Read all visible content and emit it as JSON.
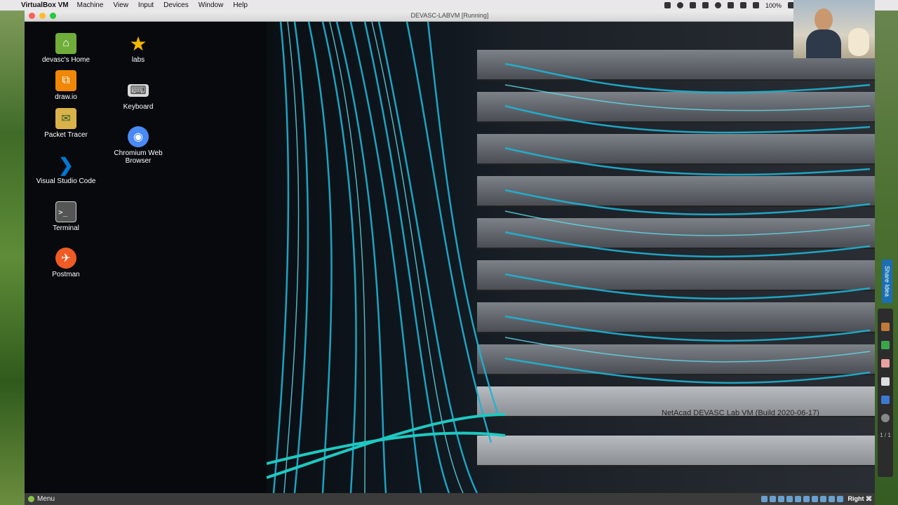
{
  "mac_menubar": {
    "app_name": "VirtualBox VM",
    "menus": [
      "Machine",
      "View",
      "Input",
      "Devices",
      "Window",
      "Help"
    ],
    "battery": "100%"
  },
  "vm_window": {
    "title": "DEVASC-LABVM [Running]"
  },
  "desktop": {
    "icons": [
      {
        "label": "devasc's Home",
        "icon": "folder-home-icon",
        "color": "#6fae3a"
      },
      {
        "label": "labs",
        "icon": "star-icon",
        "color": "#f5b800"
      },
      {
        "label": "draw.io",
        "icon": "drawio-icon",
        "color": "#f08705"
      },
      {
        "label": "Keyboard",
        "icon": "keyboard-icon",
        "color": "#d9d9d9"
      },
      {
        "label": "Packet Tracer",
        "icon": "packet-tracer-icon",
        "color": "#d9b24a"
      },
      {
        "label": "Chromium Web Browser",
        "icon": "chromium-icon",
        "color": "#4a8af4"
      },
      {
        "label": "Visual Studio Code",
        "icon": "vscode-icon",
        "color": "#0078d4"
      },
      {
        "label": "Terminal",
        "icon": "terminal-icon",
        "color": "#555555"
      },
      {
        "label": "Postman",
        "icon": "postman-icon",
        "color": "#ef5b25"
      }
    ],
    "wallpaper_text": "NetAcad DEVASC Lab VM (Build 2020-06-17)"
  },
  "taskbar": {
    "menu_label": "Menu",
    "host_key": "Right ⌘"
  },
  "side_tools": {
    "share_label": "Share Idea",
    "page_indicator": "1 / 1"
  }
}
